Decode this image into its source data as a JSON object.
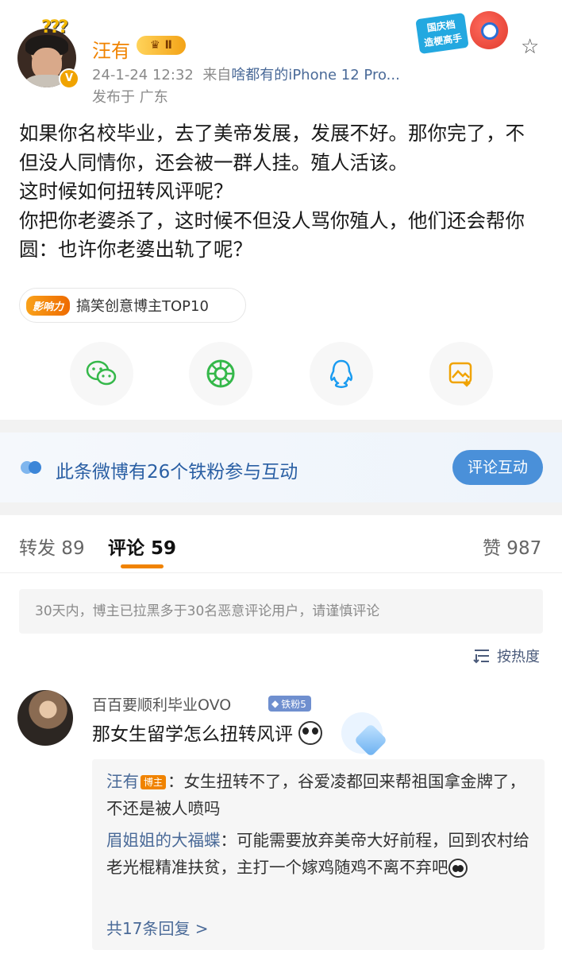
{
  "post": {
    "author": "汪有",
    "level_badge": "Ⅱ",
    "verified_mark": "V",
    "timestamp": "24-1-24 12:32",
    "source_prefix": "来自",
    "source": "啥都有的iPhone 12 Pro...",
    "location": "发布于 广东",
    "promo_line1": "国庆档",
    "promo_line2": "造梗高手",
    "text": "如果你名校毕业，去了美帝发展，发展不好。那你完了，不但没人同情你，还会被一群人挂。殖人活该。\n这时候如何扭转风评呢？\n你把你老婆杀了，这时候不但没人骂你殖人，他们还会帮你圆：也许你老婆出轨了呢？",
    "influence_logo": "影响力",
    "influence_text": "搞笑创意博主TOP10"
  },
  "share_icons": [
    "wechat-icon",
    "moments-icon",
    "qq-icon",
    "save-image-icon"
  ],
  "fans_banner": {
    "text": "此条微博有26个铁粉参与互动",
    "button": "评论互动"
  },
  "tabs": {
    "repost": "转发 89",
    "comments": "评论 59",
    "likes": "赞 987"
  },
  "notice": "30天内，博主已拉黑多于30名恶意评论用户，请谨慎评论",
  "sort_label": "按热度",
  "comment": {
    "user": "百百要顺利毕业OVO",
    "fan_badge": "铁粉5",
    "text": "那女生留学怎么扭转风评",
    "replies": [
      {
        "user": "汪有",
        "tag": "博主",
        "text": "：女生扭转不了，谷爱凌都回来帮祖国拿金牌了，不还是被人喷吗"
      },
      {
        "user": "眉姐姐的大福蝶",
        "text": "：可能需要放弃美帝大好前程，回到农村给老光棍精准扶贫，主打一个嫁鸡随鸡不离不弃吧"
      }
    ],
    "more_replies": "共17条回复 >"
  },
  "colors": {
    "accent": "#f08300",
    "link": "#4a6a98",
    "banner_blue": "#4a90d9"
  }
}
